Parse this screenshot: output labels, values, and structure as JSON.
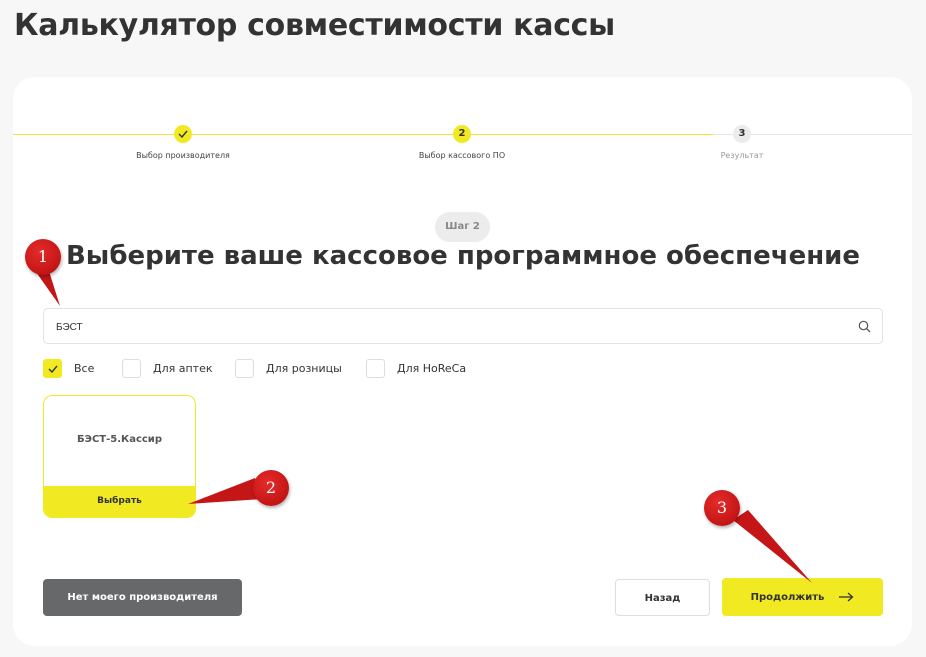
{
  "page": {
    "title": "Калькулятор совместимости кассы"
  },
  "stepper": {
    "steps": [
      {
        "number": "",
        "label": "Выбор производителя",
        "state": "done"
      },
      {
        "number": "2",
        "label": "Выбор кассового ПО",
        "state": "active"
      },
      {
        "number": "3",
        "label": "Результат",
        "state": "inactive"
      }
    ]
  },
  "main": {
    "step_badge": "Шаг 2",
    "heading": "Выберите ваше кассовое программное обеспечение",
    "search": {
      "value": "БЭСТ",
      "placeholder": "",
      "icon": "search-icon"
    },
    "filters": [
      {
        "label": "Все",
        "checked": true
      },
      {
        "label": "Для аптек",
        "checked": false
      },
      {
        "label": "Для розницы",
        "checked": false
      },
      {
        "label": "Для HoReCa",
        "checked": false
      }
    ],
    "products": [
      {
        "name": "БЭСТ-5.Кассир",
        "select_label": "Выбрать"
      }
    ]
  },
  "footer": {
    "no_maker_label": "Нет моего производителя",
    "back_label": "Назад",
    "next_label": "Продолжить",
    "next_icon": "arrow-right-icon"
  },
  "annotations": {
    "markers": [
      "1",
      "2",
      "3"
    ]
  },
  "colors": {
    "accent": "#f1ea22",
    "dark_button": "#66686a",
    "marker_red": "#d11f1f"
  }
}
